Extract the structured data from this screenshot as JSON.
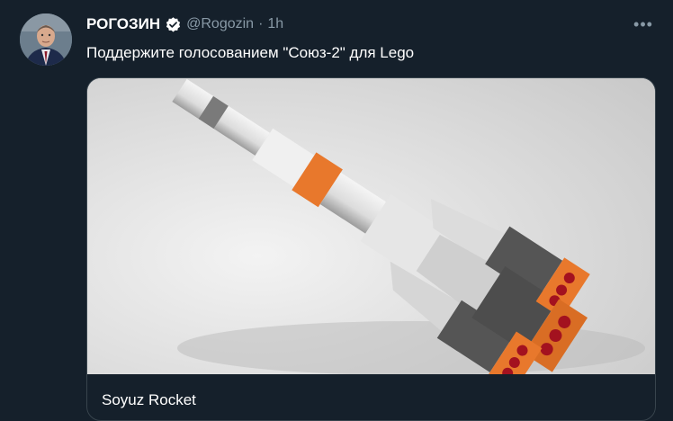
{
  "tweet": {
    "author_name": "РОГОЗИН",
    "handle": "@Rogozin",
    "separator": "·",
    "time": "1h",
    "more_label": "•••",
    "text": "Поддержите голосованием \"Союз-2\" для Lego"
  },
  "card": {
    "title": "Soyuz Rocket"
  },
  "icons": {
    "verified": "verified-badge-icon",
    "more": "more-options-icon"
  },
  "colors": {
    "background": "#15202b",
    "secondary_text": "#8899a6",
    "verified_badge": "#ffffff",
    "card_border": "#38444d"
  }
}
